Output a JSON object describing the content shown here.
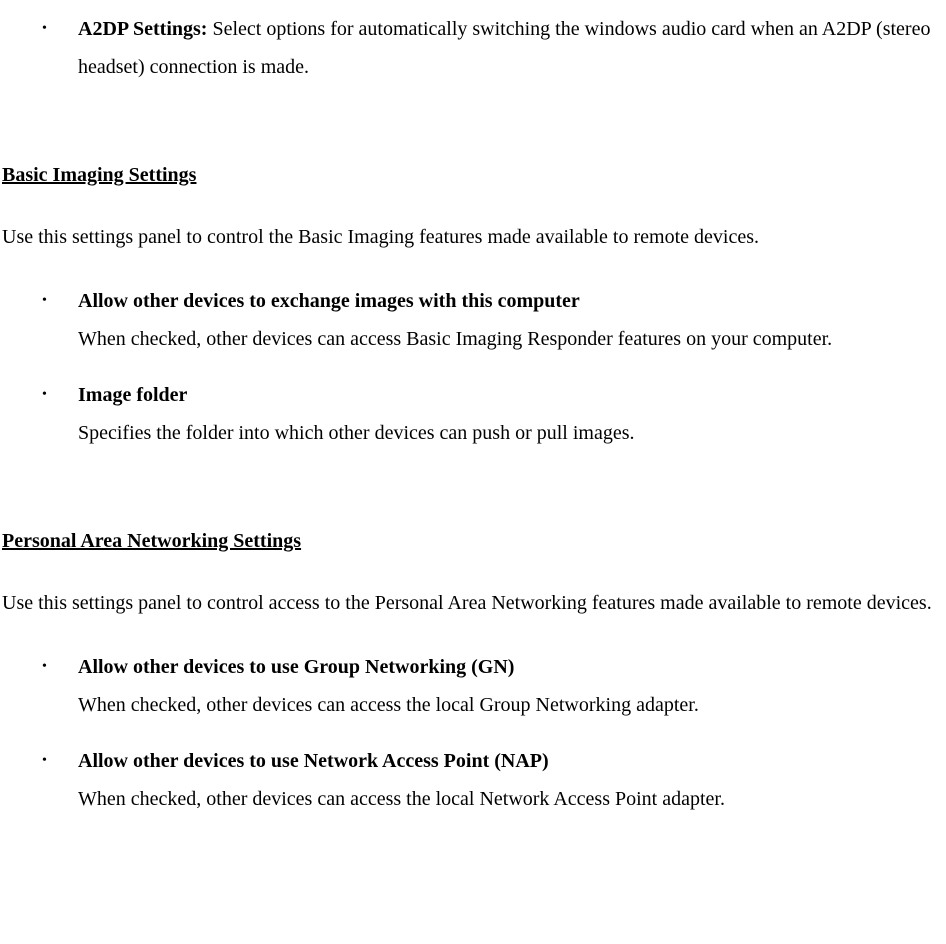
{
  "item1": {
    "title": "A2DP Settings:",
    "desc": " Select options for automatically switching the windows audio card when an A2DP (stereo headset) connection is made."
  },
  "section2": {
    "heading": "Basic Imaging Settings",
    "intro": "Use this settings panel to control the Basic Imaging features made available to remote devices.",
    "items": [
      {
        "title": "Allow other devices to exchange images with this computer",
        "desc": "When checked, other devices can access Basic Imaging Responder features on your computer."
      },
      {
        "title": "Image folder",
        "desc": "Specifies the folder into which other devices can push or pull images."
      }
    ]
  },
  "section3": {
    "heading": "Personal Area Networking Settings",
    "intro": "Use this settings panel to control access to the Personal Area Networking features made available to remote devices.",
    "items": [
      {
        "title": "Allow other devices to use Group Networking (GN)",
        "desc": "When checked, other devices can access the local Group Networking adapter."
      },
      {
        "title": "Allow other devices to use Network Access Point (NAP)",
        "desc": "When checked, other devices can access the local Network Access Point adapter."
      }
    ]
  }
}
